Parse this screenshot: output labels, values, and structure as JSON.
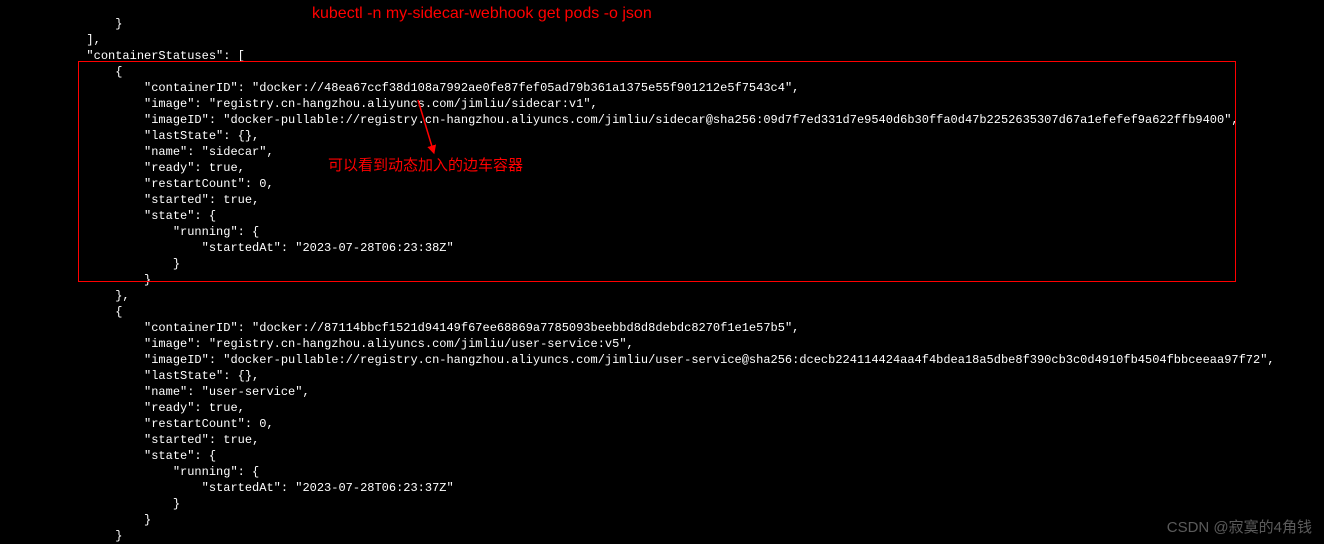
{
  "annotations": {
    "command": "kubectl -n my-sidecar-webhook get pods -o json",
    "label": "可以看到动态加入的边车容器"
  },
  "watermark": "CSDN @寂寞的4角钱",
  "json_output": {
    "pre_lines": [
      "                }",
      "            ],",
      "            \"containerStatuses\": [",
      "                {"
    ],
    "sidecar_container": {
      "containerID": "docker://48ea67ccf38d108a7992ae0fe87fef05ad79b361a1375e55f901212e5f7543c4",
      "image": "registry.cn-hangzhou.aliyuncs.com/jimliu/sidecar:v1",
      "imageID": "docker-pullable://registry.cn-hangzhou.aliyuncs.com/jimliu/sidecar@sha256:09d7f7ed331d7e9540d6b30ffa0d47b2252635307d67a1efefef9a622ffb9400",
      "lastState": "{}",
      "name": "sidecar",
      "ready": "true",
      "restartCount": "0",
      "started": "true",
      "state_running_startedAt": "2023-07-28T06:23:38Z"
    },
    "user_service_container": {
      "containerID": "docker://87114bbcf1521d94149f67ee68869a7785093beebbd8d8debdc8270f1e1e57b5",
      "image": "registry.cn-hangzhou.aliyuncs.com/jimliu/user-service:v5",
      "imageID": "docker-pullable://registry.cn-hangzhou.aliyuncs.com/jimliu/user-service@sha256:dcecb224114424aa4f4bdea18a5dbe8f390cb3c0d4910fb4504fbbceeaa97f72",
      "lastState": "{}",
      "name": "user-service",
      "ready": "true",
      "restartCount": "0",
      "started": "true",
      "state_running_startedAt": "2023-07-28T06:23:37Z"
    }
  }
}
